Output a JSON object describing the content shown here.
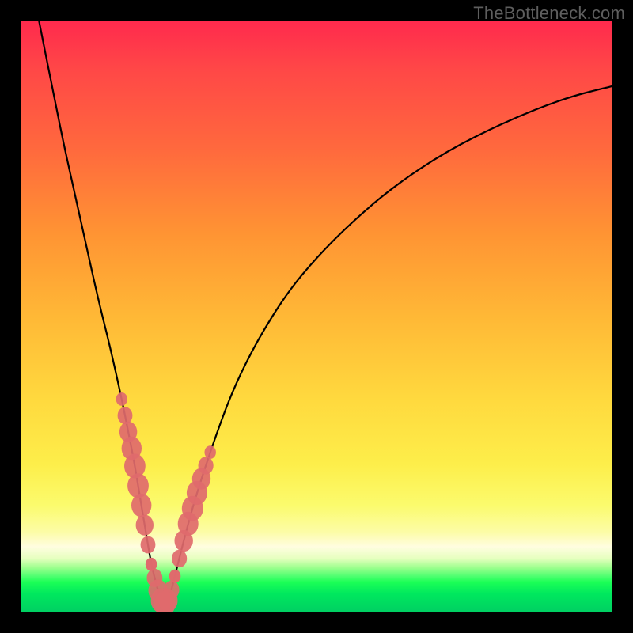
{
  "watermark": "TheBottleneck.com",
  "chart_data": {
    "type": "line",
    "title": "",
    "xlabel": "",
    "ylabel": "",
    "xlim": [
      0,
      100
    ],
    "ylim": [
      0,
      100
    ],
    "grid": false,
    "series": [
      {
        "name": "bottleneck-curve",
        "x": [
          3,
          5,
          7,
          9,
          11,
          13,
          15,
          17,
          18,
          19,
          20,
          21,
          22,
          23,
          24,
          25,
          26,
          28,
          30,
          33,
          36,
          40,
          45,
          50,
          56,
          63,
          72,
          82,
          92,
          100
        ],
        "y": [
          100,
          90,
          80,
          71,
          62,
          53,
          45,
          36,
          31,
          26,
          20,
          14,
          8,
          4,
          1,
          2,
          6,
          14,
          21,
          30,
          38,
          46,
          54,
          60,
          66,
          72,
          78,
          83,
          87,
          89
        ]
      }
    ],
    "annotations": {
      "marker_clusters": [
        {
          "name": "left-arm-markers",
          "x_range": [
            17,
            22
          ],
          "count_approx": 10,
          "color": "#e06a6d"
        },
        {
          "name": "trough-markers",
          "x_range": [
            22,
            26
          ],
          "count_approx": 8,
          "color": "#e06a6d"
        },
        {
          "name": "right-arm-markers",
          "x_range": [
            26,
            32
          ],
          "count_approx": 9,
          "color": "#e06a6d"
        }
      ]
    }
  }
}
